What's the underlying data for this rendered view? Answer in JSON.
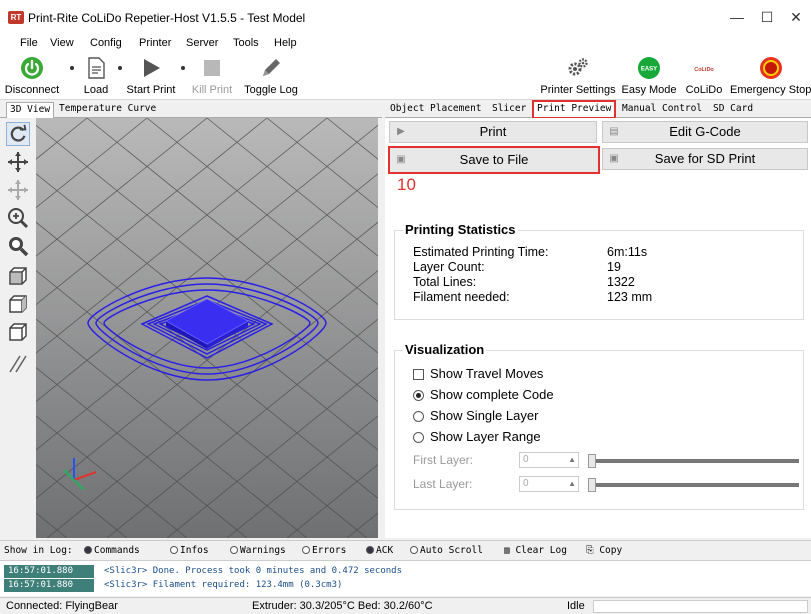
{
  "window": {
    "icon_text": "RT",
    "title": "Print-Rite CoLiDo Repetier-Host V1.5.5 - Test Model",
    "minimize_glyph": "—",
    "maximize_glyph": "☐",
    "close_glyph": "✕"
  },
  "menu": [
    "File",
    "View",
    "Config",
    "Printer",
    "Server",
    "Tools",
    "Help"
  ],
  "toolbar": {
    "disconnect": "Disconnect",
    "load": "Load",
    "start_print": "Start Print",
    "kill_print": "Kill Print",
    "toggle_log": "Toggle Log",
    "printer_settings": "Printer Settings",
    "easy_mode": "Easy Mode",
    "easy_badge": "EASY",
    "colido": "CoLiDo",
    "colido_badge": "CoLiDo",
    "emergency_stop": "Emergency Stop"
  },
  "left_tabs": [
    "3D View",
    "Temperature Curve"
  ],
  "right_tabs": [
    "Object Placement",
    "Slicer",
    "Print Preview",
    "Manual Control",
    "SD Card"
  ],
  "actions": {
    "print": "Print",
    "edit_gcode": "Edit G-Code",
    "save_to_file": "Save to File",
    "save_for_sd": "Save for SD Print",
    "step_number": "10"
  },
  "statistics": {
    "title": "Printing Statistics",
    "rows": [
      {
        "label": "Estimated Printing Time:",
        "value": "6m:11s"
      },
      {
        "label": "Layer Count:",
        "value": "19"
      },
      {
        "label": "Total Lines:",
        "value": "1322"
      },
      {
        "label": "Filament needed:",
        "value": "123 mm"
      }
    ]
  },
  "visualization": {
    "title": "Visualization",
    "show_travel": "Show Travel Moves",
    "show_complete": "Show complete Code",
    "show_single": "Show Single Layer",
    "show_range": "Show Layer Range",
    "first_layer_label": "First Layer:",
    "first_layer_value": "0",
    "last_layer_label": "Last Layer:",
    "last_layer_value": "0",
    "selected": "show_complete"
  },
  "log_bar": {
    "label": "Show in Log:",
    "commands": "Commands",
    "infos": "Infos",
    "warnings": "Warnings",
    "errors": "Errors",
    "ack": "ACK",
    "auto_scroll": "Auto Scroll",
    "clear_log": "Clear Log",
    "copy": "Copy"
  },
  "log": [
    {
      "time": "16:57:01.880",
      "message": "<Slic3r> Done. Process took 0 minutes and 0.472 seconds"
    },
    {
      "time": "16:57:01.880",
      "message": "<Slic3r> Filament required: 123.4mm (0.3cm3)"
    }
  ],
  "status": {
    "connection": "Connected: FlyingBear",
    "temps": "Extruder: 30.3/205°C Bed: 30.2/60°C",
    "state": "Idle"
  },
  "colors": {
    "accent_red": "#e0322f",
    "model_blue": "#2a1fe6",
    "grid_grey": "#8a8a8a"
  }
}
